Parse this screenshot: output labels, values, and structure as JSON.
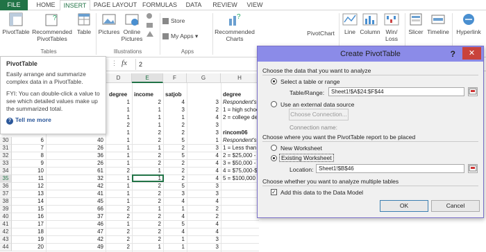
{
  "tabs": [
    "FILE",
    "HOME",
    "INSERT",
    "PAGE LAYOUT",
    "FORMULAS",
    "DATA",
    "REVIEW",
    "VIEW"
  ],
  "ribbon": {
    "pivot_table": "PivotTable",
    "recommended_pivot": [
      "Recommended",
      "PivotTables"
    ],
    "table": "Table",
    "group_tables": "Tables",
    "pictures": "Pictures",
    "online_pictures": [
      "Online",
      "Pictures"
    ],
    "group_illustrations": "Illustrations",
    "store": "Store",
    "my_apps": "My Apps",
    "group_apps": "Apps",
    "recommended_charts": [
      "Recommended",
      "Charts"
    ],
    "pivot_chart": "PivotChart",
    "line": "Line",
    "column": "Column",
    "win_loss": [
      "Win/",
      "Loss"
    ],
    "slicer": "Slicer",
    "timeline": "Timeline",
    "hyperlink": "Hyperlink"
  },
  "formula_bar": {
    "fx": "fx",
    "value": "2"
  },
  "tooltip": {
    "title": "PivotTable",
    "body1": "Easily arrange and summarize complex data in a PivotTable.",
    "body2": "FYI: You can double-click a value to see which detailed values make up the summarized total.",
    "link": "Tell me more"
  },
  "columns": [
    "D",
    "E",
    "F",
    "G",
    "H"
  ],
  "headers": {
    "D": "degree",
    "E": "income",
    "F": "satjob",
    "H": "degree"
  },
  "top_rows": [
    {
      "D": "1",
      "E": "2",
      "F": "4",
      "G": "3",
      "H": "Respondent's"
    },
    {
      "D": "1",
      "E": "1",
      "F": "3",
      "G": "2",
      "H": "1 = high schoo"
    },
    {
      "D": "1",
      "E": "1",
      "F": "1",
      "G": "4",
      "H": "2 = college deg"
    },
    {
      "D": "2",
      "E": "1",
      "F": "2",
      "G": "3",
      "H": ""
    },
    {
      "D": "1",
      "E": "2",
      "F": "2",
      "G": "3",
      "H": "rincom06"
    }
  ],
  "rows": [
    {
      "n": "30",
      "B": "6",
      "C": "40",
      "D": "1",
      "E": "2",
      "F": "5",
      "G": "1",
      "H": "Respondent's"
    },
    {
      "n": "31",
      "B": "7",
      "C": "26",
      "D": "1",
      "E": "1",
      "F": "2",
      "G": "3",
      "H": "1 = Less than $"
    },
    {
      "n": "32",
      "B": "8",
      "C": "36",
      "D": "1",
      "E": "2",
      "F": "5",
      "G": "4",
      "H": "2 = $25,000 - $4"
    },
    {
      "n": "33",
      "B": "9",
      "C": "26",
      "D": "1",
      "E": "2",
      "F": "2",
      "G": "4",
      "H": "3 = $50,000 - $"
    },
    {
      "n": "34",
      "B": "10",
      "C": "61",
      "D": "2",
      "E": "1",
      "F": "2",
      "G": "4",
      "H": "4 = $75,000-$9"
    },
    {
      "n": "35",
      "B": "11",
      "C": "32",
      "D": "1",
      "E": "1",
      "F": "2",
      "G": "4",
      "H": "5 = $100,000 or"
    },
    {
      "n": "36",
      "B": "12",
      "C": "42",
      "D": "1",
      "E": "2",
      "F": "5",
      "G": "3",
      "H": ""
    },
    {
      "n": "37",
      "B": "13",
      "C": "41",
      "D": "1",
      "E": "2",
      "F": "3",
      "G": "3",
      "H": ""
    },
    {
      "n": "38",
      "B": "14",
      "C": "45",
      "D": "1",
      "E": "2",
      "F": "4",
      "G": "4",
      "H": ""
    },
    {
      "n": "39",
      "B": "15",
      "C": "66",
      "D": "2",
      "E": "1",
      "F": "1",
      "G": "2",
      "H": ""
    },
    {
      "n": "40",
      "B": "16",
      "C": "37",
      "D": "2",
      "E": "2",
      "F": "4",
      "G": "2",
      "H": ""
    },
    {
      "n": "41",
      "B": "17",
      "C": "46",
      "D": "1",
      "E": "2",
      "F": "5",
      "G": "4",
      "H": ""
    },
    {
      "n": "42",
      "B": "18",
      "C": "47",
      "D": "2",
      "E": "2",
      "F": "4",
      "G": "4",
      "H": ""
    },
    {
      "n": "43",
      "B": "19",
      "C": "42",
      "D": "2",
      "E": "2",
      "F": "1",
      "G": "3",
      "H": ""
    },
    {
      "n": "44",
      "B": "20",
      "C": "49",
      "D": "2",
      "E": "1",
      "F": "1",
      "G": "3",
      "H": ""
    }
  ],
  "dialog": {
    "title": "Create PivotTable",
    "help": "?",
    "close": "✕",
    "choose_data": "Choose the data that you want to analyze",
    "select_range": "Select a table or range",
    "table_range_label": "Table/Range:",
    "table_range_value": "Sheet1!$A$24:$F$44",
    "use_external": "Use an external data source",
    "choose_connection": "Choose Connection...",
    "connection_name": "Connection name:",
    "choose_where": "Choose where you want the PivotTable report to be placed",
    "new_worksheet": "New Worksheet",
    "existing_worksheet": "Existing Worksheet",
    "location_label": "Location:",
    "location_value": "Sheet1!$B$46",
    "choose_multiple": "Choose whether you want to analyze multiple tables",
    "add_data_model": "Add this data to the Data Model",
    "ok": "OK",
    "cancel": "Cancel"
  }
}
